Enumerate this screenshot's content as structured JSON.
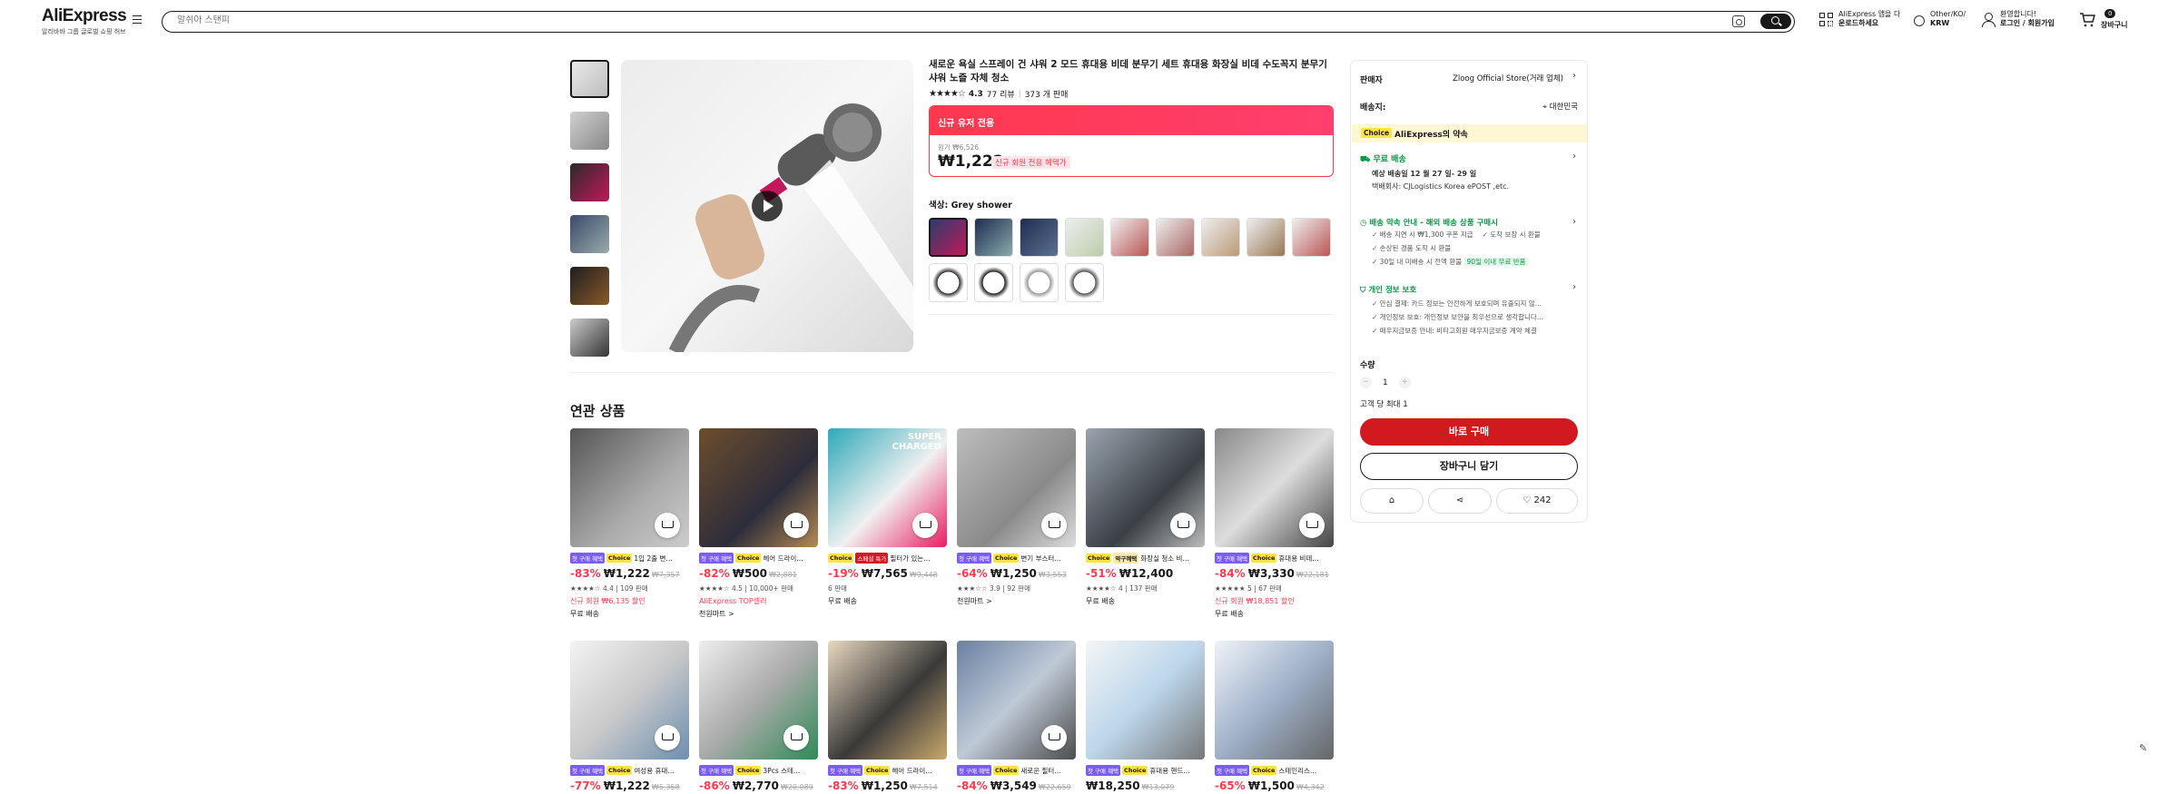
{
  "header": {
    "logo": "AliExpress",
    "logo_sub": "알리바바 그룹 글로벌 쇼핑 허브",
    "search_placeholder": "알쉬아 스탠피",
    "app_line1": "AliExpress 앱을 다",
    "app_line2": "운로드하세요",
    "locale_line1": "Other/KO/",
    "locale_line2": "KRW",
    "user_line1": "환영합니다!",
    "user_line2": "로그인 / 회원가입",
    "cart_count": "0",
    "cart_label": "장바구니"
  },
  "product": {
    "title": "새로운 욕실 스프레이 건 샤워 2 모드 휴대용 비데 분무기 세트 휴대용 화장실 비데 수도꼭지 분무기 샤워 노즐 자체 청소",
    "rating": "4.3",
    "reviews": "77 리뷰",
    "sold": "373 개 판매",
    "promo_label": "신규 유저 전용",
    "original_price": "원가 ₩6,526",
    "price": "₩1,222",
    "promo_badge": "신규 회원 전용 혜택가",
    "color_label": "색상: Grey shower"
  },
  "related": {
    "title": "연관 상품",
    "row1": [
      {
        "tag1": "첫 구매 혜택",
        "tag2": "Choice",
        "name": "1입 2출 변…",
        "disc": "-83%",
        "price": "₩1,222",
        "was": "₩7,357",
        "meta": "4.4 | 109 판매",
        "extra": "신규 회원 ₩6,135 할인",
        "extra2": "무료 배송"
      },
      {
        "tag1": "첫 구매 혜택",
        "tag2": "Choice",
        "name": "헤어 드라이…",
        "disc": "-82%",
        "price": "₩500",
        "was": "₩2,881",
        "meta": "4.5 | 10,000+ 판매",
        "extra": "AliExpress TOP셀러",
        "extra2": "천원마트 >"
      },
      {
        "tag1": "Choice",
        "tag2": "스페셜 특가",
        "name": "필터가 있는…",
        "disc": "-19%",
        "price": "₩7,565",
        "was": "₩9,448",
        "meta": "6 판매",
        "extra": "무료 배송",
        "extra2": ""
      },
      {
        "tag1": "첫 구매 혜택",
        "tag2": "Choice",
        "name": "변기 부스터…",
        "disc": "-64%",
        "price": "₩1,250",
        "was": "₩3,553",
        "meta": "3.9 | 92 판매",
        "extra": "천원마트 >",
        "extra2": ""
      },
      {
        "tag1": "Choice",
        "tag2": "약구혜택",
        "name": "화장실 청소 비…",
        "disc": "-51%",
        "price": "₩12,400",
        "was": "",
        "meta": "4 | 137 판매",
        "extra": "무료 배송",
        "extra2": ""
      },
      {
        "tag1": "첫 구매 혜택",
        "tag2": "Choice",
        "name": "휴대용 비데…",
        "disc": "-84%",
        "price": "₩3,330",
        "was": "₩22,181",
        "meta": "5 | 67 판매",
        "extra": "신규 회원 ₩18,851 할인",
        "extra2": "무료 배송"
      }
    ],
    "row2": [
      {
        "tag1": "첫 구매 혜택",
        "tag2": "Choice",
        "name": "여성용 휴대…",
        "disc": "-77%",
        "price": "₩1,222",
        "was": "₩5,358"
      },
      {
        "tag1": "첫 구매 혜택",
        "tag2": "Choice",
        "name": "3Pcs 스테…",
        "disc": "-86%",
        "price": "₩2,770",
        "was": "₩20,089"
      },
      {
        "tag1": "첫 구매 혜택",
        "tag2": "Choice",
        "name": "헤어 드라이…",
        "disc": "-83%",
        "price": "₩1,250",
        "was": "₩7,514"
      },
      {
        "tag1": "첫 구매 혜택",
        "tag2": "Choice",
        "name": "새로운 필터…",
        "disc": "-84%",
        "price": "₩3,549",
        "was": "₩22,659"
      },
      {
        "tag1": "첫 구매 혜택",
        "tag2": "Choice",
        "name": "휴대용 핸드…",
        "disc": "",
        "price": "₩18,250",
        "was": "₩13,079"
      },
      {
        "tag1": "첫 구매 혜택",
        "tag2": "Choice",
        "name": "스테인리스…",
        "disc": "-65%",
        "price": "₩1,500",
        "was": "₩4,342"
      }
    ]
  },
  "panel": {
    "seller_label": "판매자",
    "seller_name": "Zloog Official Store(거래 업체)",
    "ship_label": "배송지:",
    "ship_to": "대한민국",
    "choice": "Choice",
    "choice_text": "AliExpress의 약속",
    "free_ship": "무료 배송",
    "delivery": "예상 배송일 12 월 27 일- 29 일",
    "carrier": "택배회사: CJLogistics Korea ePOST ,etc.",
    "promise_title": "배송 약속 안내 - 해외 배송 상품 구매시",
    "promise": [
      "배송 지연 시 ₩1,300 쿠폰 지급",
      "도착 보장 시 환불",
      "손상된 경품 도착 시 환불",
      "30일 내 미배송 시 전액 환불"
    ],
    "promise_badge": "90일 이내 무료 반품",
    "privacy_title": "개인 정보 보호",
    "privacy": [
      "안심 결제: 카드 정보는 안전하게 보호되며 유출되지 않...",
      "개인정보 보호: 개인정보 보안을 최우선으로 생각합니다...",
      "매우지금보증 안내: 비티고회원 매우지금보증 계약 체결"
    ],
    "qty_label": "수량",
    "qty": "1",
    "limit": "고객 당 최대 1",
    "buy_now": "바로 구매",
    "add_cart": "장바구니 담기",
    "wish_count": "242"
  }
}
